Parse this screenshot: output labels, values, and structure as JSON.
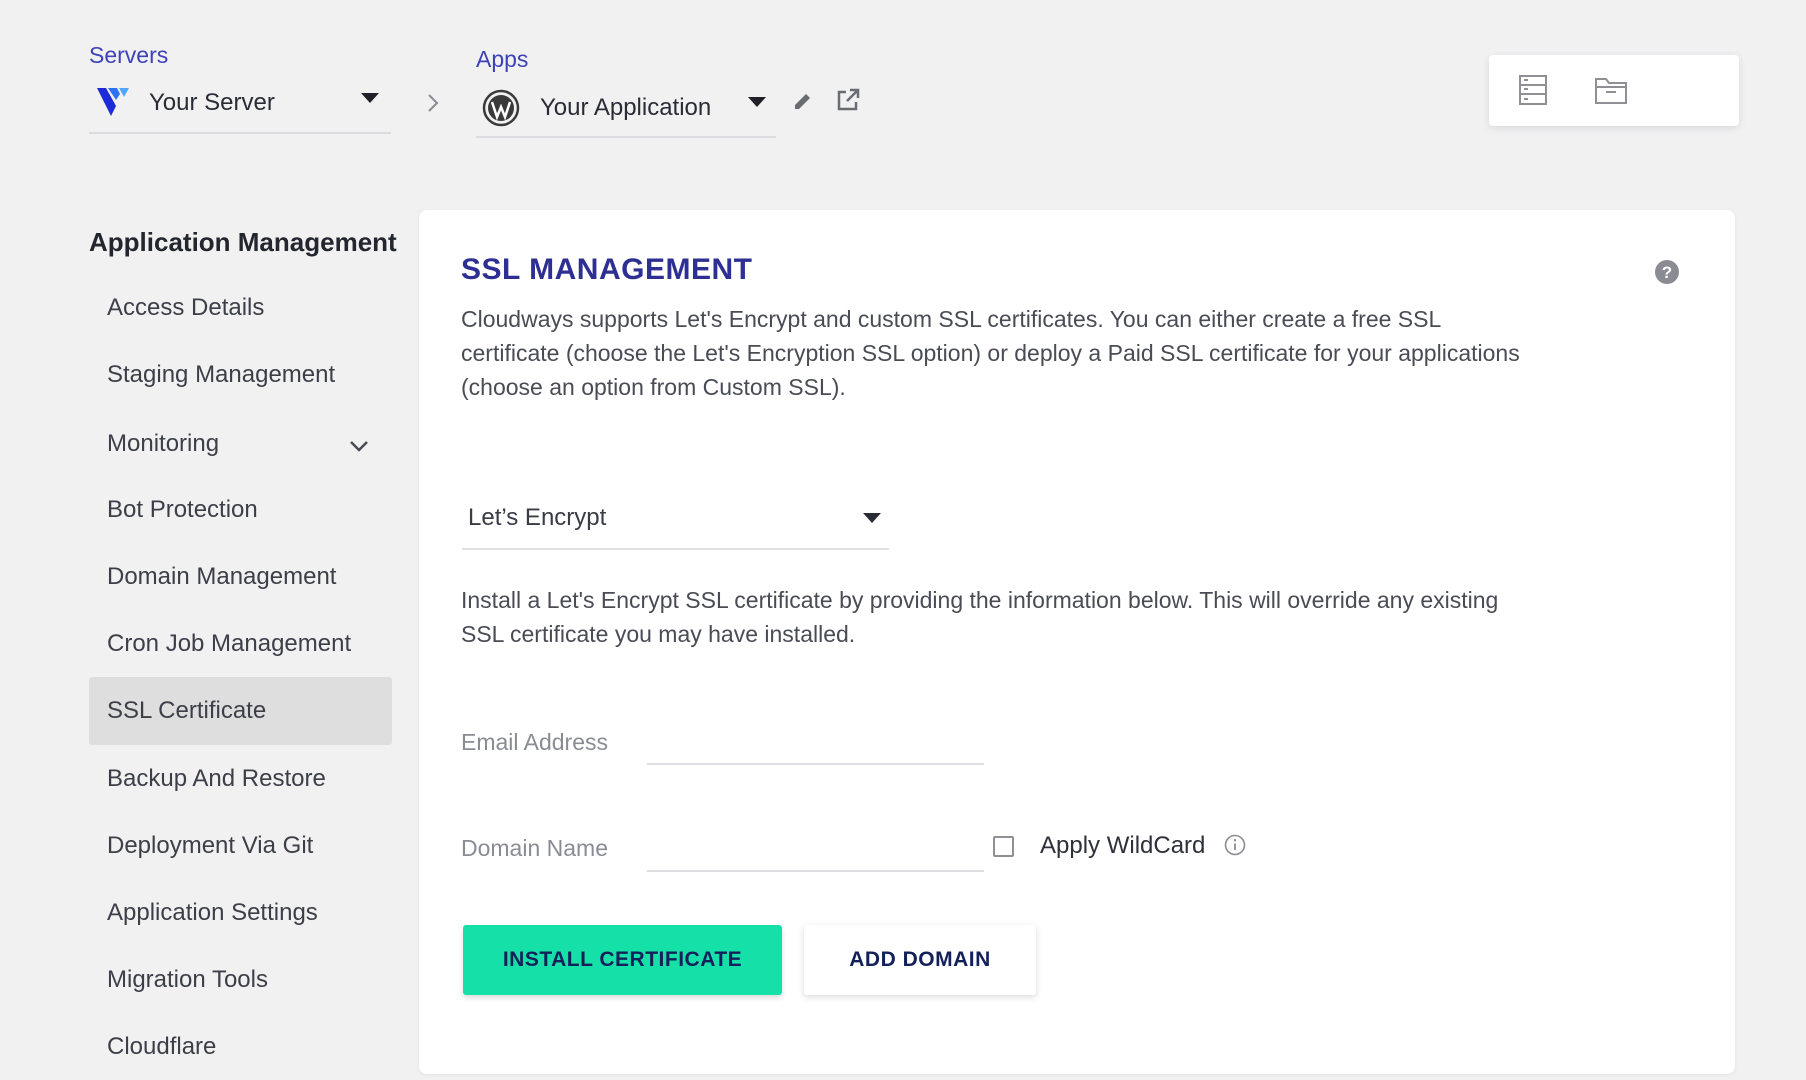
{
  "header": {
    "servers_label": "Servers",
    "server_name": "Your Server",
    "apps_label": "Apps",
    "app_name": "Your Application"
  },
  "sidebar": {
    "title": "Application Management",
    "items": [
      {
        "label": "Access Details"
      },
      {
        "label": "Staging Management"
      },
      {
        "label": "Monitoring"
      },
      {
        "label": "Bot Protection"
      },
      {
        "label": "Domain Management"
      },
      {
        "label": "Cron Job Management"
      },
      {
        "label": "SSL Certificate",
        "active": true
      },
      {
        "label": "Backup And Restore"
      },
      {
        "label": "Deployment Via Git"
      },
      {
        "label": "Application Settings"
      },
      {
        "label": "Migration Tools"
      },
      {
        "label": "Cloudflare"
      }
    ]
  },
  "main": {
    "title": "SSL MANAGEMENT",
    "description": "Cloudways supports Let's Encrypt and custom SSL certificates. You can either create a free SSL certificate (choose the Let's Encryption SSL option) or deploy a Paid SSL certificate for your applications (choose an option from Custom SSL).",
    "ssl_type_selected": "Let’s Encrypt",
    "install_info": "Install a Let's Encrypt SSL certificate by providing the information below. This will override any existing SSL certificate you may have installed.",
    "email_label": "Email Address",
    "email_value": "",
    "domain_label": "Domain Name",
    "domain_value": "",
    "wildcard_label": "Apply WildCard",
    "wildcard_checked": false,
    "install_button": "INSTALL CERTIFICATE",
    "add_domain_button": "ADD DOMAIN"
  },
  "colors": {
    "accent": "#3d43b7",
    "title": "#2d2f93",
    "primary_button": "#14e0a8",
    "background": "#f1f1f2"
  }
}
